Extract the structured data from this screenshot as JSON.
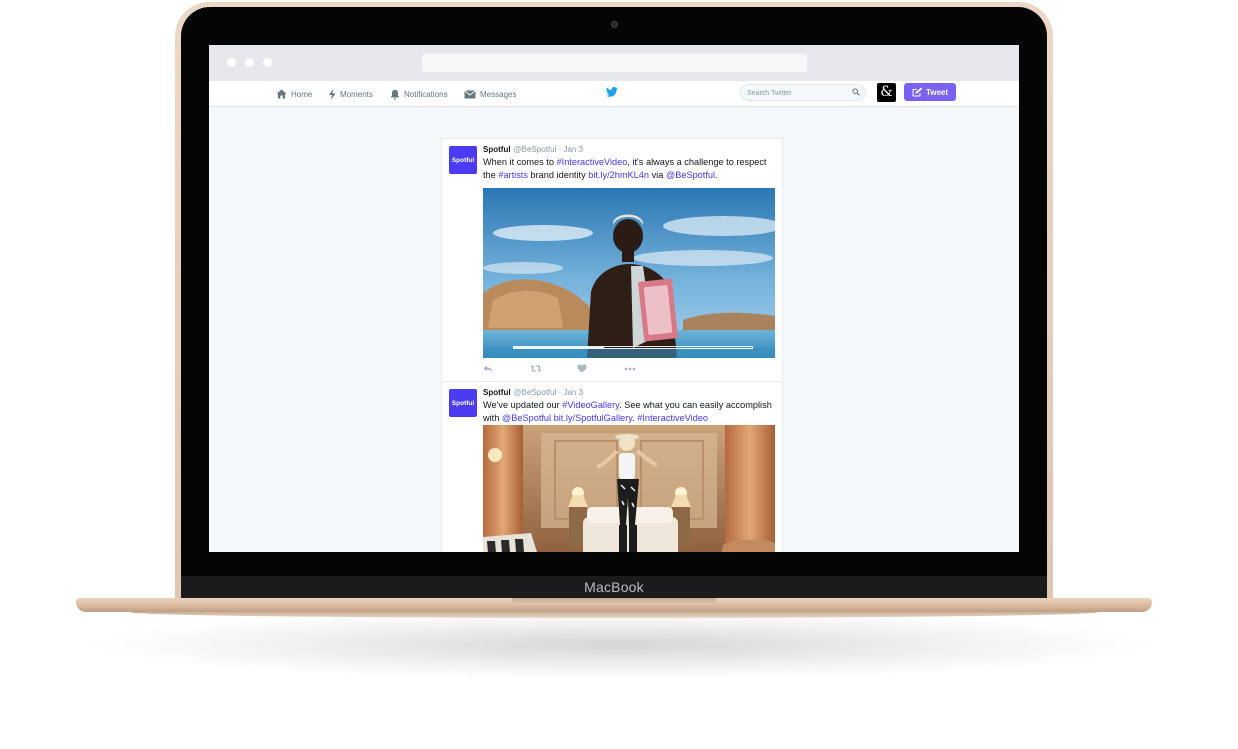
{
  "device": {
    "brand_label": "MacBook"
  },
  "colors": {
    "accent": "#7b61f1",
    "link": "#4337e8",
    "avatar": "#4b3cf2",
    "twitter_blue": "#1da1f2"
  },
  "nav": {
    "items": [
      {
        "label": "Home",
        "icon": "home-icon"
      },
      {
        "label": "Moments",
        "icon": "lightning-icon"
      },
      {
        "label": "Notifications",
        "icon": "bell-icon"
      },
      {
        "label": "Messages",
        "icon": "envelope-icon"
      }
    ],
    "logo_icon": "twitter-bird-icon",
    "search_placeholder": "Search Twitter",
    "tweet_button": "Tweet"
  },
  "tweets": [
    {
      "avatar_label": "Spotful",
      "name": "Spotful",
      "handle": "@BeSpotful · Jan 3",
      "text": {
        "t1": "When it comes to ",
        "l1": "#InteractiveVideo",
        "t2": ", it's always a challenge to respect the ",
        "l2": "#artists",
        "t3": " brand identity ",
        "l3": "bit.ly/2hmKL4n",
        "t4": " via ",
        "l4": "@BeSpotful",
        "t5": "."
      },
      "video_progress": 0.38
    },
    {
      "avatar_label": "Spotful",
      "name": "Spotful",
      "handle": "@BeSpotful · Jan 3",
      "text": {
        "t1": "We've updated our ",
        "l1": "#VideoGallery",
        "t2": ". See what you can easily accomplish with ",
        "l2": "@BeSpotful",
        "t3": " ",
        "l3": "bit.ly/SpotfulGallery",
        "t4": ". ",
        "l4": "#InteractiveVideo"
      }
    }
  ]
}
